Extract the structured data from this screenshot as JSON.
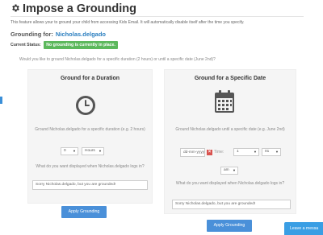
{
  "page": {
    "title": "Impose a Grounding",
    "description": "This feature allows your to ground your child from accessing Kids Email. It will automatically disable itself after the time you specify.",
    "grounding_for_label": "Grounding for:",
    "grounding_for_user": "Nicholas.delgado",
    "current_status_label": "Current Status:",
    "current_status_value": "No grounding is currently in place.",
    "question": "Would you like to ground Nicholas.delgado for a specific duration (2 hours) or until a specific date (June 2nd)?",
    "status_color": "#5cb85c",
    "accent_color": "#4a90d9"
  },
  "duration_panel": {
    "title": "Ground for a Duration",
    "icon": "clock-icon",
    "description": "Ground Nicholas.delgado for a specific duration (e.g. 2 hours)",
    "amount_value": "0",
    "unit_value": "Hours",
    "message_prompt": "What do you want displayed when Nicholas.delgado logs in?",
    "message_value": "Sorry Nicholas.delgado, but you are grounded!",
    "button_label": "Apply Grounding"
  },
  "date_panel": {
    "title": "Ground for a Specific Date",
    "icon": "calendar-icon",
    "description": "Ground Nicholas.delgado until a specific date (e.g. June 2nd)",
    "date_placeholder": "dd-mm-yyyy",
    "time_label": "Time:",
    "hour_value": "1",
    "minute_value": "01",
    "ampm_value": "am",
    "message_prompt": "What do you want displayed when Nicholas.delgado logs in?",
    "message_value": "Sorry Nicholas.delgado, but you are grounded!",
    "button_label": "Apply Grounding"
  },
  "chat": {
    "label": "Leave a messa"
  }
}
